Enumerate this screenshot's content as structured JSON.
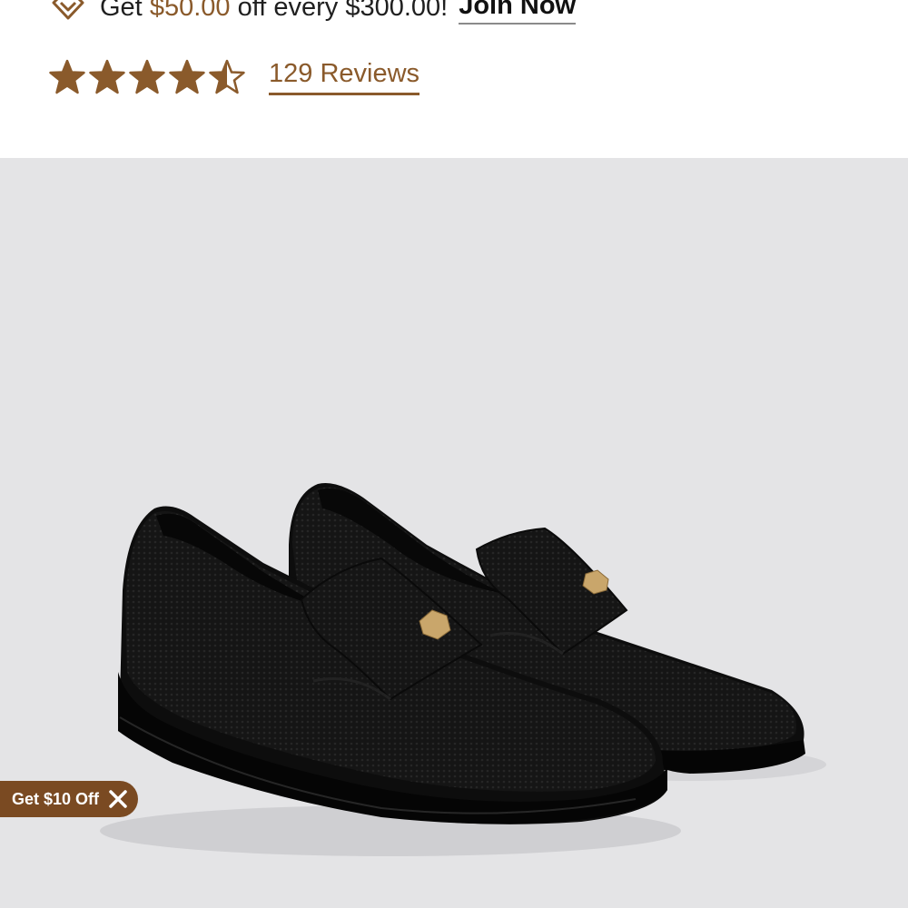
{
  "promo": {
    "prefix": "Get ",
    "amount": "$50.00",
    "suffix": " off every $300.00!",
    "join_label": "Join Now",
    "icon": "diamond-icon"
  },
  "rating": {
    "value": 4.5,
    "max": 5,
    "reviews_label": "129 Reviews"
  },
  "product": {
    "image": "black-knit-penny-loafers"
  },
  "discount_pill": {
    "label": "Get $10 Off",
    "close_icon": "close-icon"
  },
  "colors": {
    "accent": "#8a5a2b",
    "pill": "#7a4a22",
    "image_bg": "#e4e4e6"
  }
}
